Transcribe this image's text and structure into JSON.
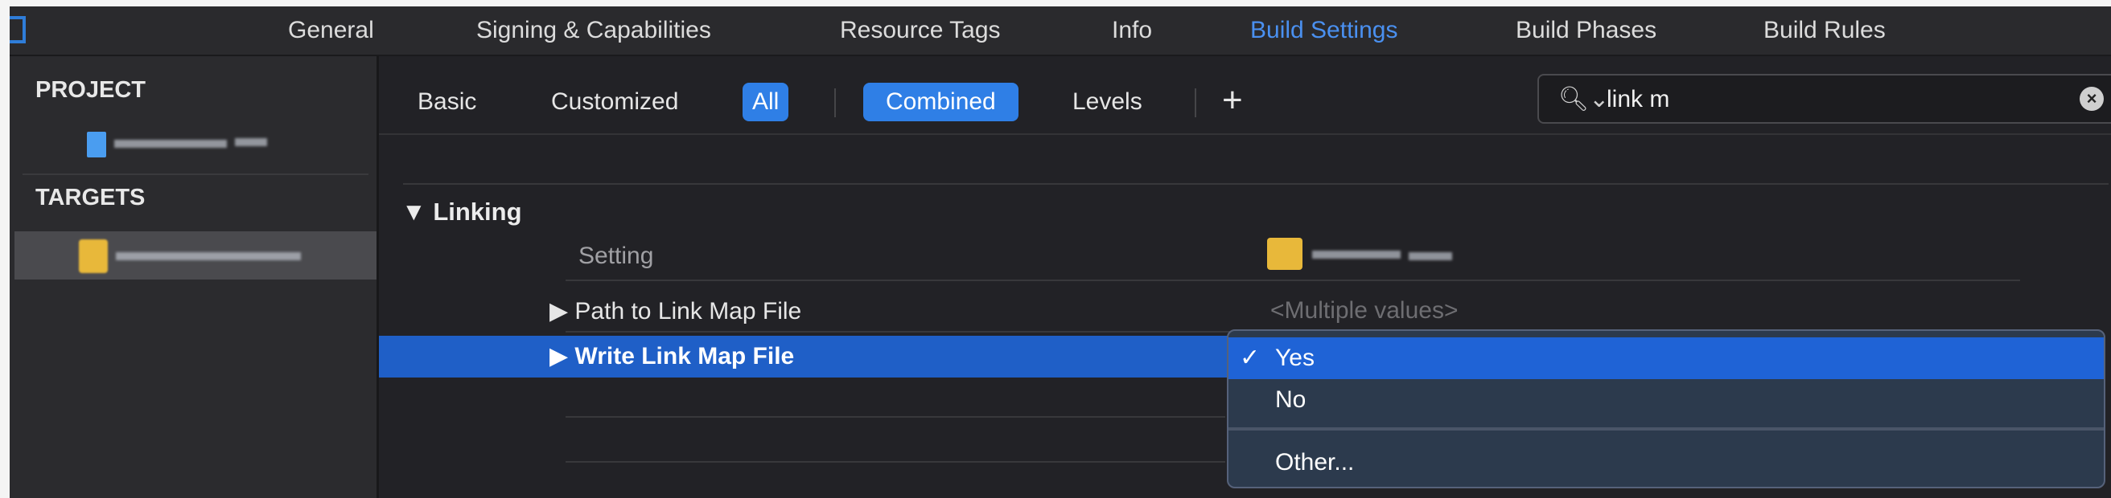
{
  "tabs": [
    {
      "label": "General",
      "active": false
    },
    {
      "label": "Signing & Capabilities",
      "active": false
    },
    {
      "label": "Resource Tags",
      "active": false
    },
    {
      "label": "Info",
      "active": false
    },
    {
      "label": "Build Settings",
      "active": true
    },
    {
      "label": "Build Phases",
      "active": false
    },
    {
      "label": "Build Rules",
      "active": false
    }
  ],
  "sidebar": {
    "project_header": "PROJECT",
    "targets_header": "TARGETS"
  },
  "filters": {
    "basic": "Basic",
    "customized": "Customized",
    "all": "All",
    "combined": "Combined",
    "levels": "Levels",
    "add": "+"
  },
  "search": {
    "icon": "magnifier-dropdown-icon",
    "value": "link m",
    "clear": "×"
  },
  "section": {
    "title": "Linking",
    "disclosure": "▼",
    "column_setting": "Setting"
  },
  "rows": [
    {
      "disclosure": "▶",
      "label": "Path to Link Map File",
      "value": "<Multiple values>"
    },
    {
      "disclosure": "▶",
      "label": "Write Link Map File",
      "value": "Yes",
      "selected": true
    }
  ],
  "popup": {
    "items": [
      {
        "check": "✓",
        "label": "Yes",
        "highlight": true
      },
      {
        "check": "",
        "label": "No",
        "highlight": false
      },
      {
        "check": "",
        "label": "Other...",
        "highlight": false
      }
    ]
  },
  "colors": {
    "accent": "#2f7fe6",
    "selection": "#1f5fc7",
    "active_tab": "#4a90f0",
    "target_icon": "#e8b83a"
  }
}
